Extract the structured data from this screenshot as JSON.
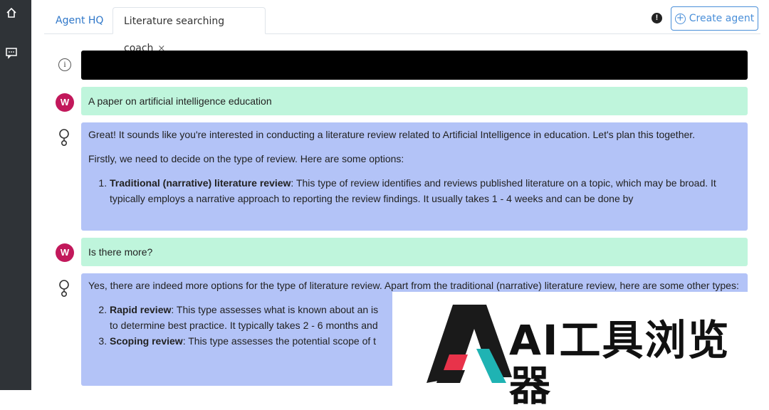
{
  "sidebar": {
    "home_icon": "home-icon",
    "chat_icon": "chat-icon"
  },
  "tabs": {
    "hq": "Agent HQ",
    "active": "Literature searching coach",
    "close": "×"
  },
  "header": {
    "alert": "!",
    "create_label": "Create agent",
    "create_icon": "+"
  },
  "messages": {
    "info_glyph": "i",
    "m1": {
      "avatar": "W",
      "text": "A paper on artificial intelligence education"
    },
    "m2": {
      "p1": "Great! It sounds like you're interested in conducting a literature review related to Artificial Intelligence in education. Let's plan this together.",
      "p2": "Firstly, we need to decide on the type of review. Here are some options:",
      "item1_title": "Traditional (narrative) literature review",
      "item1_text": ": This type of review identifies and reviews published literature on a topic, which may be broad. It typically employs a narrative approach to reporting the review findings. It usually takes 1 - 4 weeks and can be done by"
    },
    "m3": {
      "avatar": "W",
      "text": "Is there more?"
    },
    "m4": {
      "p1": "Yes, there are indeed more options for the type of literature review. Apart from the traditional (narrative) literature review, here are some other types:",
      "item2_title": "Rapid review",
      "item2_text": ": This type assesses what is known about an is",
      "item2_cont": "to determine best practice. It typically takes 2 - 6 months and",
      "item3_title": "Scoping review",
      "item3_text": ": This type assesses the potential scope of t"
    }
  },
  "watermark": {
    "text": "AI工具浏览器"
  },
  "colors": {
    "user_bubble": "#bff5dc",
    "bot_bubble": "#b3c3f7",
    "accent": "#4a8fd9",
    "avatar": "#c2185b",
    "rail": "#2f3337"
  }
}
